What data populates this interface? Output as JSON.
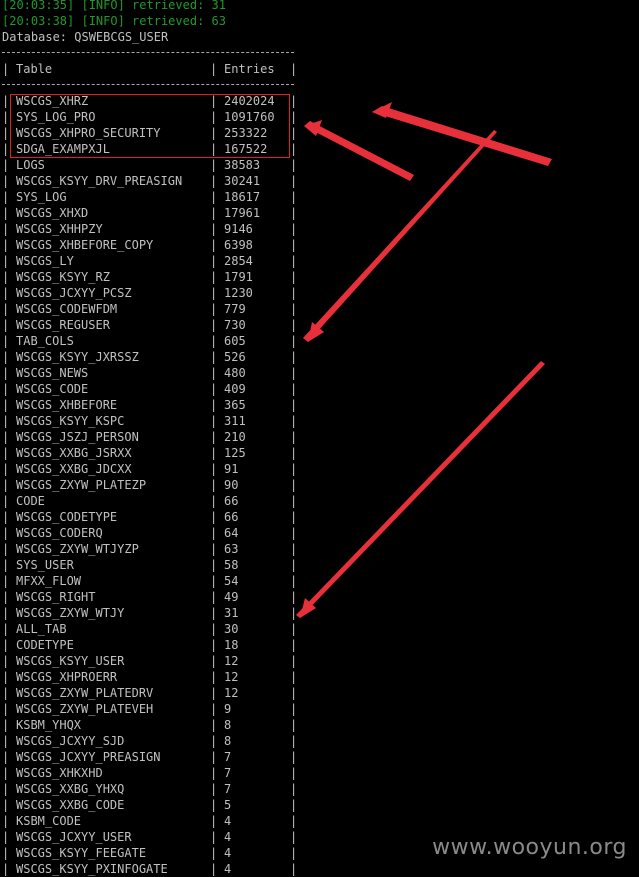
{
  "log": [
    "[20:03:35] [INFO] retrieved: 31",
    "[20:03:38] [INFO] retrieved: 63"
  ],
  "database_line": "Database: QSWEBCGS_USER",
  "table": {
    "headers": [
      "Table",
      "Entries"
    ],
    "rows": [
      [
        "WSCGS_XHRZ",
        "2402024"
      ],
      [
        "SYS_LOG_PRO",
        "1091760"
      ],
      [
        "WSCGS_XHPRO_SECURITY",
        "253322"
      ],
      [
        "SDGA_EXAMPXJL",
        "167522"
      ],
      [
        "LOGS",
        "38583"
      ],
      [
        "WSCGS_KSYY_DRV_PREASIGN",
        "30241"
      ],
      [
        "SYS_LOG",
        "18617"
      ],
      [
        "WSCGS_XHXD",
        "17961"
      ],
      [
        "WSCGS_XHHPZY",
        "9146"
      ],
      [
        "WSCGS_XHBEFORE_COPY",
        "6398"
      ],
      [
        "WSCGS_LY",
        "2854"
      ],
      [
        "WSCGS_KSYY_RZ",
        "1791"
      ],
      [
        "WSCGS_JCXYY_PCSZ",
        "1230"
      ],
      [
        "WSCGS_CODEWFDM",
        "779"
      ],
      [
        "WSCGS_REGUSER",
        "730"
      ],
      [
        "TAB_COLS",
        "605"
      ],
      [
        "WSCGS_KSYY_JXRSSZ",
        "526"
      ],
      [
        "WSCGS_NEWS",
        "480"
      ],
      [
        "WSCGS_CODE",
        "409"
      ],
      [
        "WSCGS_XHBEFORE",
        "365"
      ],
      [
        "WSCGS_KSYY_KSPC",
        "311"
      ],
      [
        "WSCGS_JSZJ_PERSON",
        "210"
      ],
      [
        "WSCGS_XXBG_JSRXX",
        "125"
      ],
      [
        "WSCGS_XXBG_JDCXX",
        "91"
      ],
      [
        "WSCGS_ZXYW_PLATEZP",
        "90"
      ],
      [
        "CODE",
        "66"
      ],
      [
        "WSCGS_CODETYPE",
        "66"
      ],
      [
        "WSCGS_CODERQ",
        "64"
      ],
      [
        "WSCGS_ZXYW_WTJYZP",
        "63"
      ],
      [
        "SYS_USER",
        "58"
      ],
      [
        "MFXX_FLOW",
        "54"
      ],
      [
        "WSCGS_RIGHT",
        "49"
      ],
      [
        "WSCGS_ZXYW_WTJY",
        "31"
      ],
      [
        "ALL_TAB",
        "30"
      ],
      [
        "CODETYPE",
        "18"
      ],
      [
        "WSCGS_KSYY_USER",
        "12"
      ],
      [
        "WSCGS_XHPROERR",
        "12"
      ],
      [
        "WSCGS_ZXYW_PLATEDRV",
        "12"
      ],
      [
        "WSCGS_ZXYW_PLATEVEH",
        "9"
      ],
      [
        "KSBM_YHQX",
        "8"
      ],
      [
        "WSCGS_JCXYY_SJD",
        "8"
      ],
      [
        "WSCGS_JCXYY_PREASIGN",
        "7"
      ],
      [
        "WSCGS_XHKXHD",
        "7"
      ],
      [
        "WSCGS_XXBG_YHXQ",
        "7"
      ],
      [
        "WSCGS_XXBG_CODE",
        "5"
      ],
      [
        "KSBM_CODE",
        "4"
      ],
      [
        "WSCGS_JCXYY_USER",
        "4"
      ],
      [
        "WSCGS_KSYY_FEEGATE",
        "4"
      ],
      [
        "WSCGS_KSYY_PXINFOGATE",
        "4"
      ]
    ]
  },
  "colors": {
    "background": "#000000",
    "text": "#c0c0c0",
    "info": "#1f9a2a",
    "annotation": "#e8303a"
  },
  "watermark": "www.wooyun.org"
}
